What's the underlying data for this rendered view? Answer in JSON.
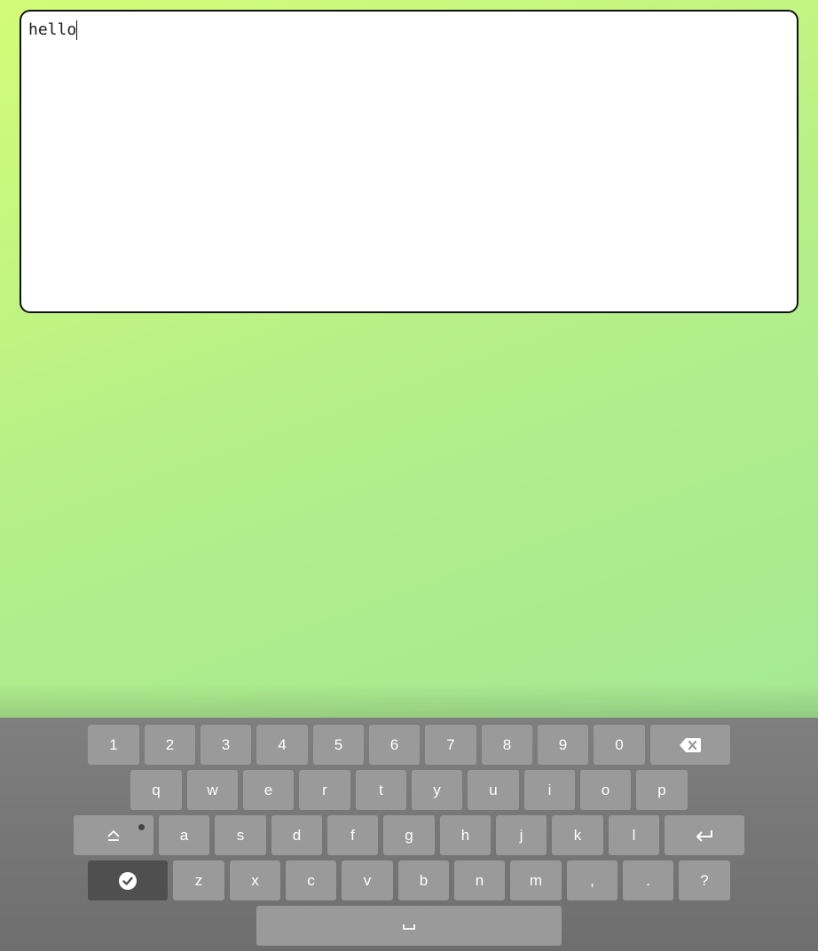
{
  "editor": {
    "text": "hello"
  },
  "keyboard": {
    "number_row": [
      "1",
      "2",
      "3",
      "4",
      "5",
      "6",
      "7",
      "8",
      "9",
      "0"
    ],
    "row1": [
      "q",
      "w",
      "e",
      "r",
      "t",
      "y",
      "u",
      "i",
      "o",
      "p"
    ],
    "row2": [
      "a",
      "s",
      "d",
      "f",
      "g",
      "h",
      "j",
      "k",
      "l"
    ],
    "row3": [
      "z",
      "x",
      "c",
      "v",
      "b",
      "n",
      "m",
      ",",
      ".",
      "?"
    ],
    "icons": {
      "backspace": "backspace-icon",
      "shift": "shift-icon",
      "enter": "enter-icon",
      "done": "checkmark-icon",
      "space": "space-icon"
    },
    "colors": {
      "key": "#9a9a9a",
      "key_dark": "#4f4f4f",
      "background": "#747474"
    }
  }
}
